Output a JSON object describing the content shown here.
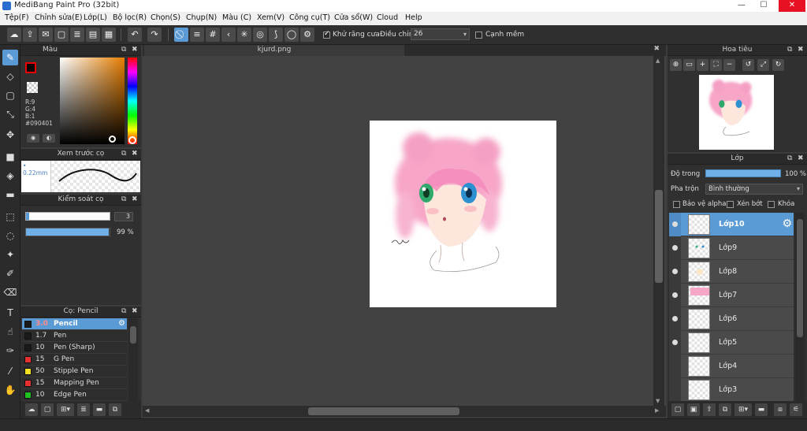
{
  "window": {
    "title": "MediBang Paint Pro (32bit)",
    "minimize": "—",
    "maximize": "☐",
    "close": "✕"
  },
  "menu": [
    "Tệp(F)",
    "Chỉnh sửa(E)",
    "Lớp(L)",
    "Bộ lọc(R)",
    "Chọn(S)",
    "Chụp(N)",
    "Màu (C)",
    "Xem(V)",
    "Công cụ(T)",
    "Cửa sổ(W)",
    "Cloud",
    "Help"
  ],
  "toolbar": {
    "antialias_label": "Khử răng cưa",
    "antialias_checked": true,
    "adjust_label": "Điều chỉnh",
    "adjust_value": "26",
    "smooth_edge_label": "Cạnh mềm",
    "smooth_edge_checked": false
  },
  "color_panel": {
    "title": "Màu",
    "r": "R:9",
    "g": "G:4",
    "b": "B:1",
    "hex": "#090401",
    "fg_color": "#090401"
  },
  "brush_preview": {
    "title": "Xem trước cọ",
    "size": "0.22mm"
  },
  "brush_control": {
    "title": "Kiểm soát cọ",
    "size_value": "3",
    "opacity_value": "99 %",
    "opacity": 0.99
  },
  "brush_list": {
    "title": "Cọ: Pencil",
    "items": [
      {
        "size": "3.0",
        "name": "Pencil",
        "color": "#1a1a1a",
        "selected": true
      },
      {
        "size": "1.7",
        "name": "Pen",
        "color": "#1a1a1a",
        "selected": false
      },
      {
        "size": "10",
        "name": "Pen (Sharp)",
        "color": "#1a1a1a",
        "selected": false
      },
      {
        "size": "15",
        "name": "G Pen",
        "color": "#e53030",
        "selected": false
      },
      {
        "size": "50",
        "name": "Stipple Pen",
        "color": "#f0e020",
        "selected": false
      },
      {
        "size": "15",
        "name": "Mapping Pen",
        "color": "#e53030",
        "selected": false
      },
      {
        "size": "10",
        "name": "Edge Pen",
        "color": "#20c020",
        "selected": false
      }
    ]
  },
  "canvas": {
    "tab_name": "kjurd.png"
  },
  "navigator": {
    "title": "Hoa tiêu"
  },
  "layers": {
    "title": "Lớp",
    "opacity_label": "Độ trong",
    "opacity_value": "100 %",
    "blend_label": "Pha trộn",
    "blend_value": "Bình thường",
    "protect_alpha": "Bảo vệ alpha",
    "clipping": "Xén bớt",
    "lock": "Khóa",
    "items": [
      {
        "name": "Lớp10",
        "visible": true,
        "selected": true
      },
      {
        "name": "Lớp9",
        "visible": true,
        "selected": false
      },
      {
        "name": "Lớp8",
        "visible": true,
        "selected": false
      },
      {
        "name": "Lớp7",
        "visible": true,
        "selected": false
      },
      {
        "name": "Lớp6",
        "visible": true,
        "selected": false
      },
      {
        "name": "Lớp5",
        "visible": true,
        "selected": false
      },
      {
        "name": "Lớp4",
        "visible": false,
        "selected": false
      },
      {
        "name": "Lớp3",
        "visible": false,
        "selected": false
      }
    ]
  }
}
